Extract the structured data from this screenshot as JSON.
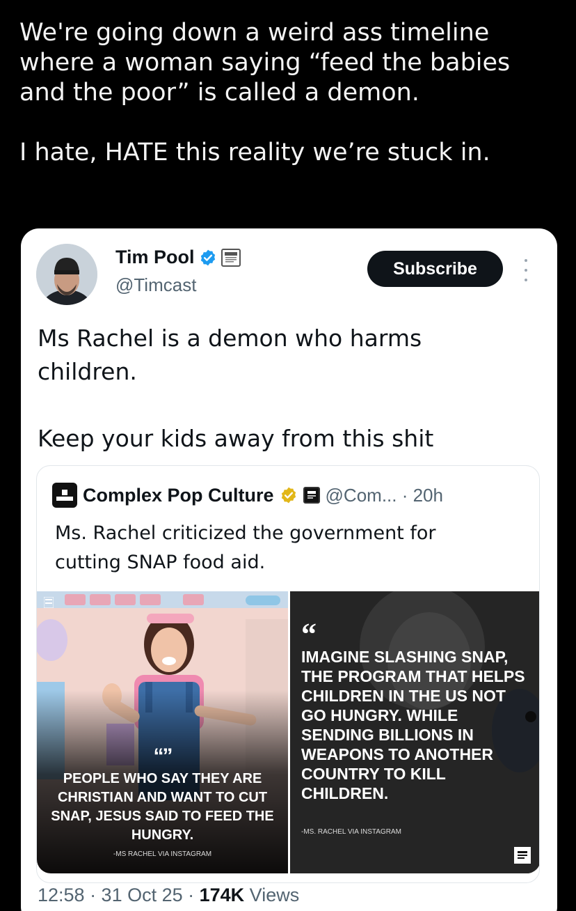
{
  "caption": {
    "line1": "We're going down a weird ass timeline",
    "line2": "where a woman saying “feed the babies",
    "line3": "and the poor” is called a demon.",
    "line4": "I hate, HATE  this reality we’re stuck in."
  },
  "tweet": {
    "author_name": "Tim Pool",
    "author_handle": "@Timcast",
    "subscribe_label": "Subscribe",
    "body_line1": "Ms Rachel is a demon who harms",
    "body_line2": "children.",
    "body_line3": "Keep your kids away from this shit",
    "timestamp": "12:58 · 31 Oct 25 · ",
    "views_count": "174K",
    "views_label": " Views"
  },
  "quoted": {
    "author_name": "Complex Pop Culture",
    "author_handle": "@Com... · 20h",
    "text_line1": "Ms. Rachel criticized the government for",
    "text_line2": "cutting SNAP food aid.",
    "image_left": {
      "quote_mark": "“”",
      "quote_text": "People who say they are Christian and want to cut SNAP, Jesus said to feed the hungry.",
      "attribution": "-MS RACHEL VIA INSTAGRAM"
    },
    "image_right": {
      "quote_mark": "“",
      "quote_text": "Imagine slashing SNAP, the program that helps children in the US not go hungry. While sending billions in weapons to another country to kill children.",
      "attribution": "-MS. RACHEL VIA INSTAGRAM"
    }
  },
  "colors": {
    "background": "#000000",
    "card": "#ffffff",
    "verified_blue": "#1d9bf0",
    "verified_gold": "#e2b719",
    "subscribe_bg": "#0f1419"
  }
}
